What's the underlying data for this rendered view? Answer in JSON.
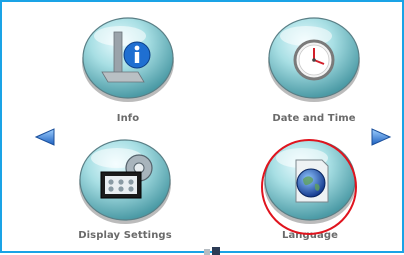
{
  "screen": {
    "tiles": [
      {
        "id": "info",
        "label": "Info",
        "icon": "info-icon"
      },
      {
        "id": "date-time",
        "label": "Date and Time",
        "icon": "clock-icon"
      },
      {
        "id": "display-settings",
        "label": "Display Settings",
        "icon": "display-gear-icon"
      },
      {
        "id": "language",
        "label": "Language",
        "icon": "globe-document-icon"
      }
    ],
    "nav": {
      "prev": "left-arrow-icon",
      "next": "right-arrow-icon"
    },
    "highlight": {
      "target": "language",
      "color": "#e0141e"
    },
    "colors": {
      "frame": "#1aa3e6",
      "button_glass": "#7fc9d1",
      "label": "#6a6a6a",
      "arrow": "#2f7fd8"
    }
  }
}
